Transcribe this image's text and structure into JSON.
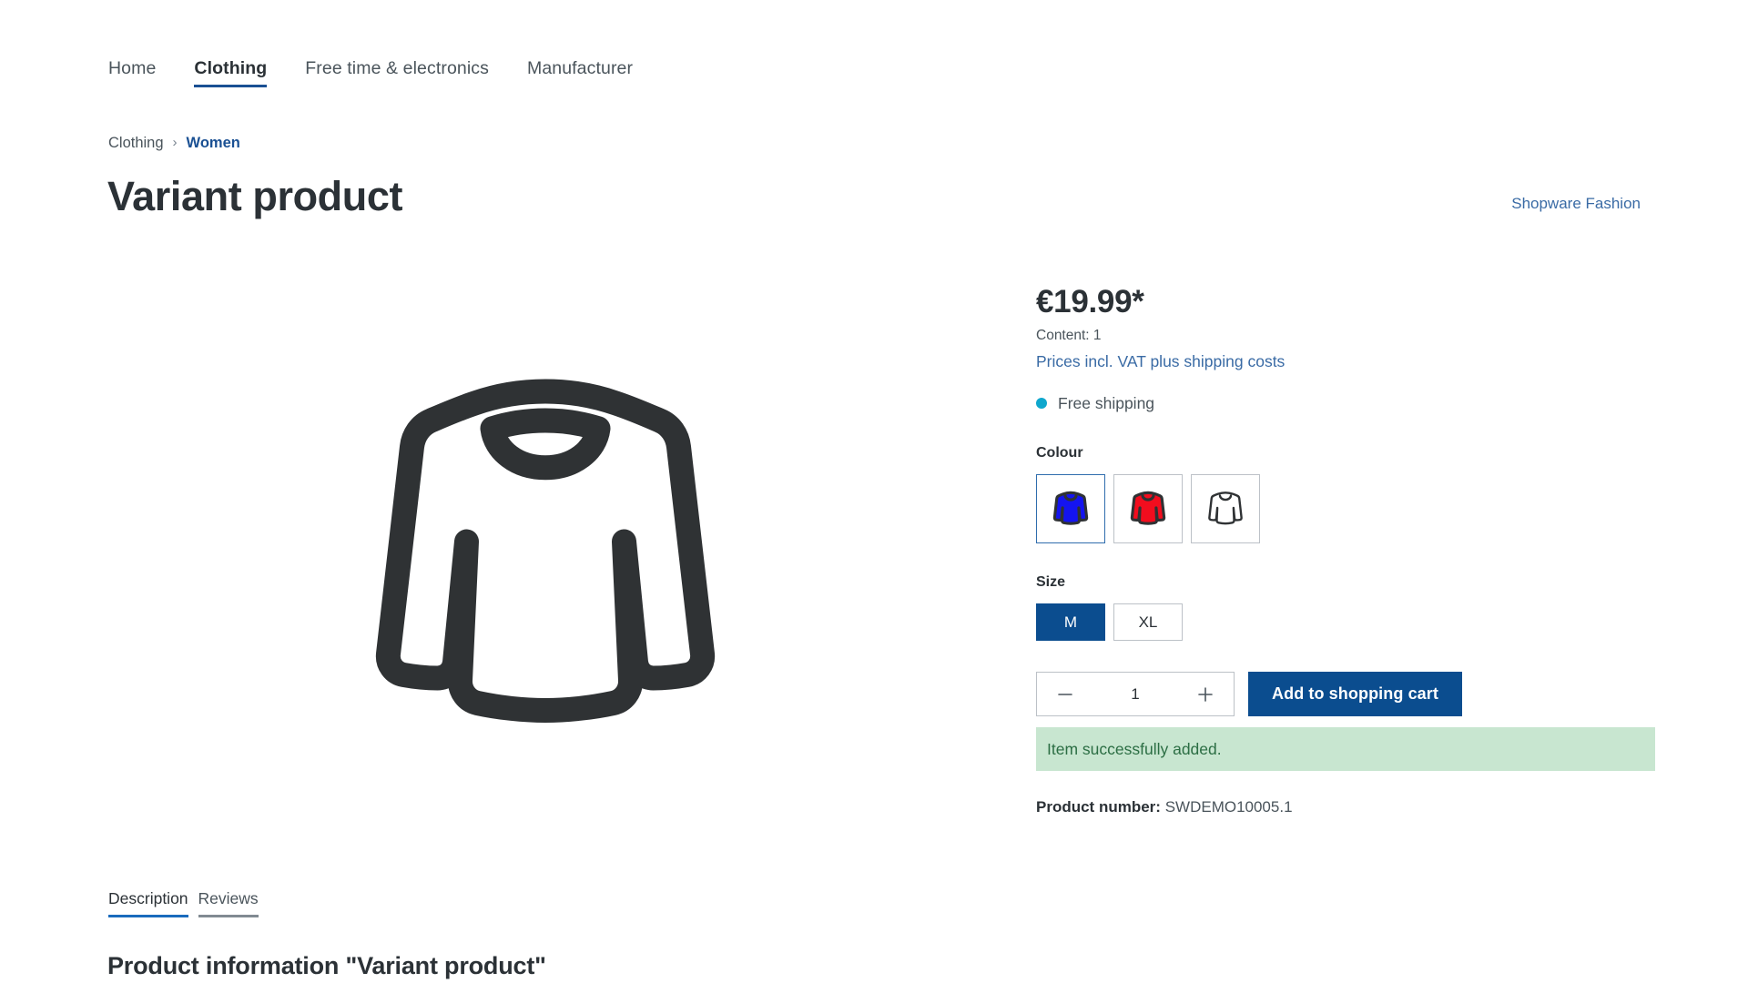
{
  "nav": {
    "items": [
      {
        "label": "Home",
        "active": false
      },
      {
        "label": "Clothing",
        "active": true
      },
      {
        "label": "Free time & electronics",
        "active": false
      },
      {
        "label": "Manufacturer",
        "active": false
      }
    ]
  },
  "breadcrumb": {
    "parent": "Clothing",
    "separator": "›",
    "current": "Women"
  },
  "title": "Variant product",
  "manufacturer": {
    "label": "Shopware Fashion"
  },
  "gallery": {
    "image_alt": "long-sleeve-shirt-illustration",
    "outline_color": "#2f3234"
  },
  "buybox": {
    "price": "€19.99*",
    "content": "Content: 1",
    "tax_note": "Prices incl. VAT plus shipping costs",
    "delivery": {
      "text": "Free shipping",
      "dot_color": "#0fa7cd"
    },
    "colour": {
      "label": "Colour",
      "options": [
        {
          "name": "blue",
          "fill": "#1414f0",
          "selected": true
        },
        {
          "name": "red",
          "fill": "#f20d1e",
          "selected": false
        },
        {
          "name": "white",
          "fill": "#ffffff",
          "selected": false
        }
      ]
    },
    "size": {
      "label": "Size",
      "options": [
        {
          "label": "M",
          "selected": true
        },
        {
          "label": "XL",
          "selected": false
        }
      ]
    },
    "quantity": {
      "value": "1",
      "decrease_icon": "minus-icon",
      "increase_icon": "plus-icon"
    },
    "add_to_cart_label": "Add to shopping cart",
    "alert": {
      "text": "Item successfully added.",
      "background": "#c8e6d0",
      "color": "#2c6e44"
    },
    "product_number_label": "Product number:",
    "product_number_value": "SWDEMO10005.1"
  },
  "detail_tabs": [
    {
      "label": "Description",
      "active": true
    },
    {
      "label": "Reviews",
      "active": false
    }
  ],
  "section_heading": "Product information \"Variant product\"",
  "colors": {
    "accent": "#0b4d8f",
    "link": "#3a6ba5",
    "text": "#2b3136",
    "muted": "#4a545b",
    "border": "#bcc1c7"
  }
}
